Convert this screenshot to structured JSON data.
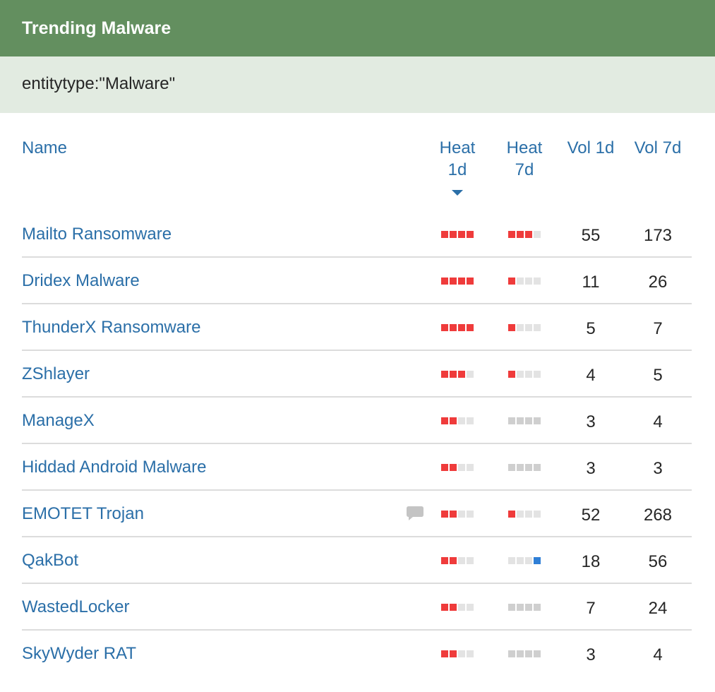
{
  "header": {
    "title": "Trending Malware",
    "color": "#638f5f"
  },
  "query": {
    "text": "entitytype:\"Malware\""
  },
  "columns": {
    "name": "Name",
    "heat1d": [
      "Heat",
      "1d"
    ],
    "heat7d": [
      "Heat",
      "7d"
    ],
    "vol1d": "Vol 1d",
    "vol7d": "Vol 7d",
    "sorted_by": "heat1d",
    "sort_direction": "descending"
  },
  "heat_scale_max": 4,
  "rows": [
    {
      "name": "Mailto Ransomware",
      "heat1d": 4,
      "heat7d": 3,
      "heat7d_style": "red",
      "vol1d": "55",
      "vol7d": "173",
      "comment": false
    },
    {
      "name": "Dridex Malware",
      "heat1d": 4,
      "heat7d": 1,
      "heat7d_style": "red",
      "vol1d": "11",
      "vol7d": "26",
      "comment": false
    },
    {
      "name": "ThunderX Ransomware",
      "heat1d": 4,
      "heat7d": 1,
      "heat7d_style": "red",
      "vol1d": "5",
      "vol7d": "7",
      "comment": false
    },
    {
      "name": "ZShlayer",
      "heat1d": 3,
      "heat7d": 1,
      "heat7d_style": "red",
      "vol1d": "4",
      "vol7d": "5",
      "comment": false
    },
    {
      "name": "ManageX",
      "heat1d": 2,
      "heat7d": 0,
      "heat7d_style": "gray",
      "vol1d": "3",
      "vol7d": "4",
      "comment": false
    },
    {
      "name": "Hiddad Android Malware",
      "heat1d": 2,
      "heat7d": 0,
      "heat7d_style": "gray",
      "vol1d": "3",
      "vol7d": "3",
      "comment": false
    },
    {
      "name": "EMOTET Trojan",
      "heat1d": 2,
      "heat7d": 1,
      "heat7d_style": "red",
      "vol1d": "52",
      "vol7d": "268",
      "comment": true
    },
    {
      "name": "QakBot",
      "heat1d": 2,
      "heat7d": 1,
      "heat7d_style": "blue",
      "vol1d": "18",
      "vol7d": "56",
      "comment": false
    },
    {
      "name": "WastedLocker",
      "heat1d": 2,
      "heat7d": 0,
      "heat7d_style": "gray",
      "vol1d": "7",
      "vol7d": "24",
      "comment": false
    },
    {
      "name": "SkyWyder RAT",
      "heat1d": 2,
      "heat7d": 0,
      "heat7d_style": "gray",
      "vol1d": "3",
      "vol7d": "4",
      "comment": false
    }
  ],
  "icons": {
    "sort": "caret-down-icon",
    "comment": "speech-bubble-icon"
  },
  "colors": {
    "link": "#2b6fa8",
    "heat_red": "#ef3b3b",
    "heat_blue": "#2f7fd6",
    "heat_empty": "#e3e3e3",
    "heat_gray": "#cfcfcf"
  }
}
